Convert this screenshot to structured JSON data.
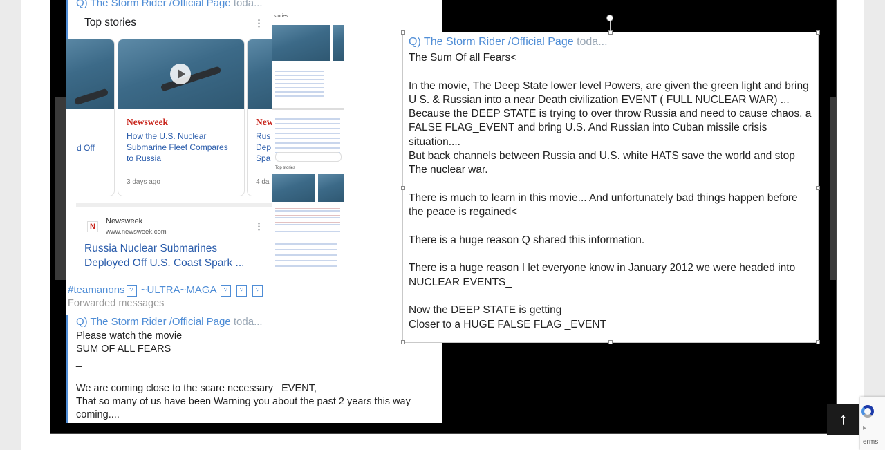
{
  "left_panel": {
    "top_header": {
      "author": "Q) The Storm Rider /Official Page",
      "time": "toda..."
    },
    "embed": {
      "top_stories_title": "Top stories",
      "card_left": {
        "headline_fragment": "d Off"
      },
      "card_main": {
        "brand": "Newsweek",
        "headline": "How the U.S. Nuclear Submarine Fleet Compares to Russia",
        "age": "3 days ago"
      },
      "card_right": {
        "brand_fragment": "New",
        "headline_fragment": "Rus\nDep\nSpa",
        "age_fragment": "4 da"
      },
      "result": {
        "source": "Newsweek",
        "domain": "www.newsweek.com",
        "headline": "Russia Nuclear Submarines Deployed Off U.S. Coast Spark ..."
      }
    },
    "thumbs": {
      "top_label": "stories",
      "mid_label": "Top stories"
    },
    "tags": {
      "hashtag": "#teamanons",
      "sep": "~ULTRA~MAGA",
      "box": "?"
    },
    "forwarded": "Forwarded messages",
    "message": {
      "author": "Q) The Storm Rider /Official Page",
      "time": "toda...",
      "text": "Please watch the movie\nSUM OF ALL FEARS\n_\n\nWe are coming close to the scare necessary _EVENT,\nThat so many of us have been Warning you about the past 2 years this way\ncoming...."
    }
  },
  "overlay": {
    "author": "Q) The Storm Rider /Official Page",
    "time": "toda...",
    "text": "The Sum Of all Fears<\n\nIn the movie, The Deep State lower level Powers, are given the green light and bring U S. & Russian into a near Death civilization EVENT ( FULL NUCLEAR WAR) ... Because the DEEP STATE is trying to over throw Russia and need to cause chaos, a FALSE FLAG_EVENT and bring U.S. And Russian into Cuban missile crisis situation....\nBut back channels between Russia and U.S. white HATS save the world and stop The nuclear war.\n\nThere is much to learn in this movie... And unfortunately bad things happen before the peace is regained<\n\nThere is a huge reason Q shared this information.\n\nThere is a huge reason I let everyone know in January 2012 we were headed into NUCLEAR EVENTS_\n___\nNow the DEEP STATE is getting\nCloser to a HUGE FALSE FLAG _EVENT"
  },
  "scroll_top": {
    "icon": "arrow-up-icon"
  },
  "recaptcha": {
    "fragment": "erms"
  }
}
